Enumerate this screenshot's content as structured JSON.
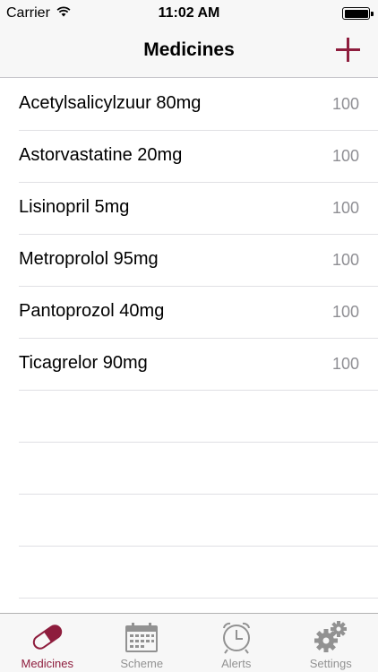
{
  "status_bar": {
    "carrier": "Carrier",
    "time": "11:02 AM",
    "icons": [
      "wifi-icon",
      "battery-icon"
    ]
  },
  "nav": {
    "title": "Medicines",
    "add_icon": "plus-icon",
    "accent": "#8e1d3d"
  },
  "medicines": [
    {
      "name": "Acetylsalicylzuur 80mg",
      "count": "100"
    },
    {
      "name": "Astorvastatine 20mg",
      "count": "100"
    },
    {
      "name": "Lisinopril 5mg",
      "count": "100"
    },
    {
      "name": "Metroprolol 95mg",
      "count": "100"
    },
    {
      "name": "Pantoprozol 40mg",
      "count": "100"
    },
    {
      "name": "Ticagrelor 90mg",
      "count": "100"
    }
  ],
  "tabs": [
    {
      "label": "Medicines",
      "icon": "pill-icon",
      "active": true
    },
    {
      "label": "Scheme",
      "icon": "calendar-icon",
      "active": false
    },
    {
      "label": "Alerts",
      "icon": "alarm-clock-icon",
      "active": false
    },
    {
      "label": "Settings",
      "icon": "gear-icon",
      "active": false
    }
  ]
}
